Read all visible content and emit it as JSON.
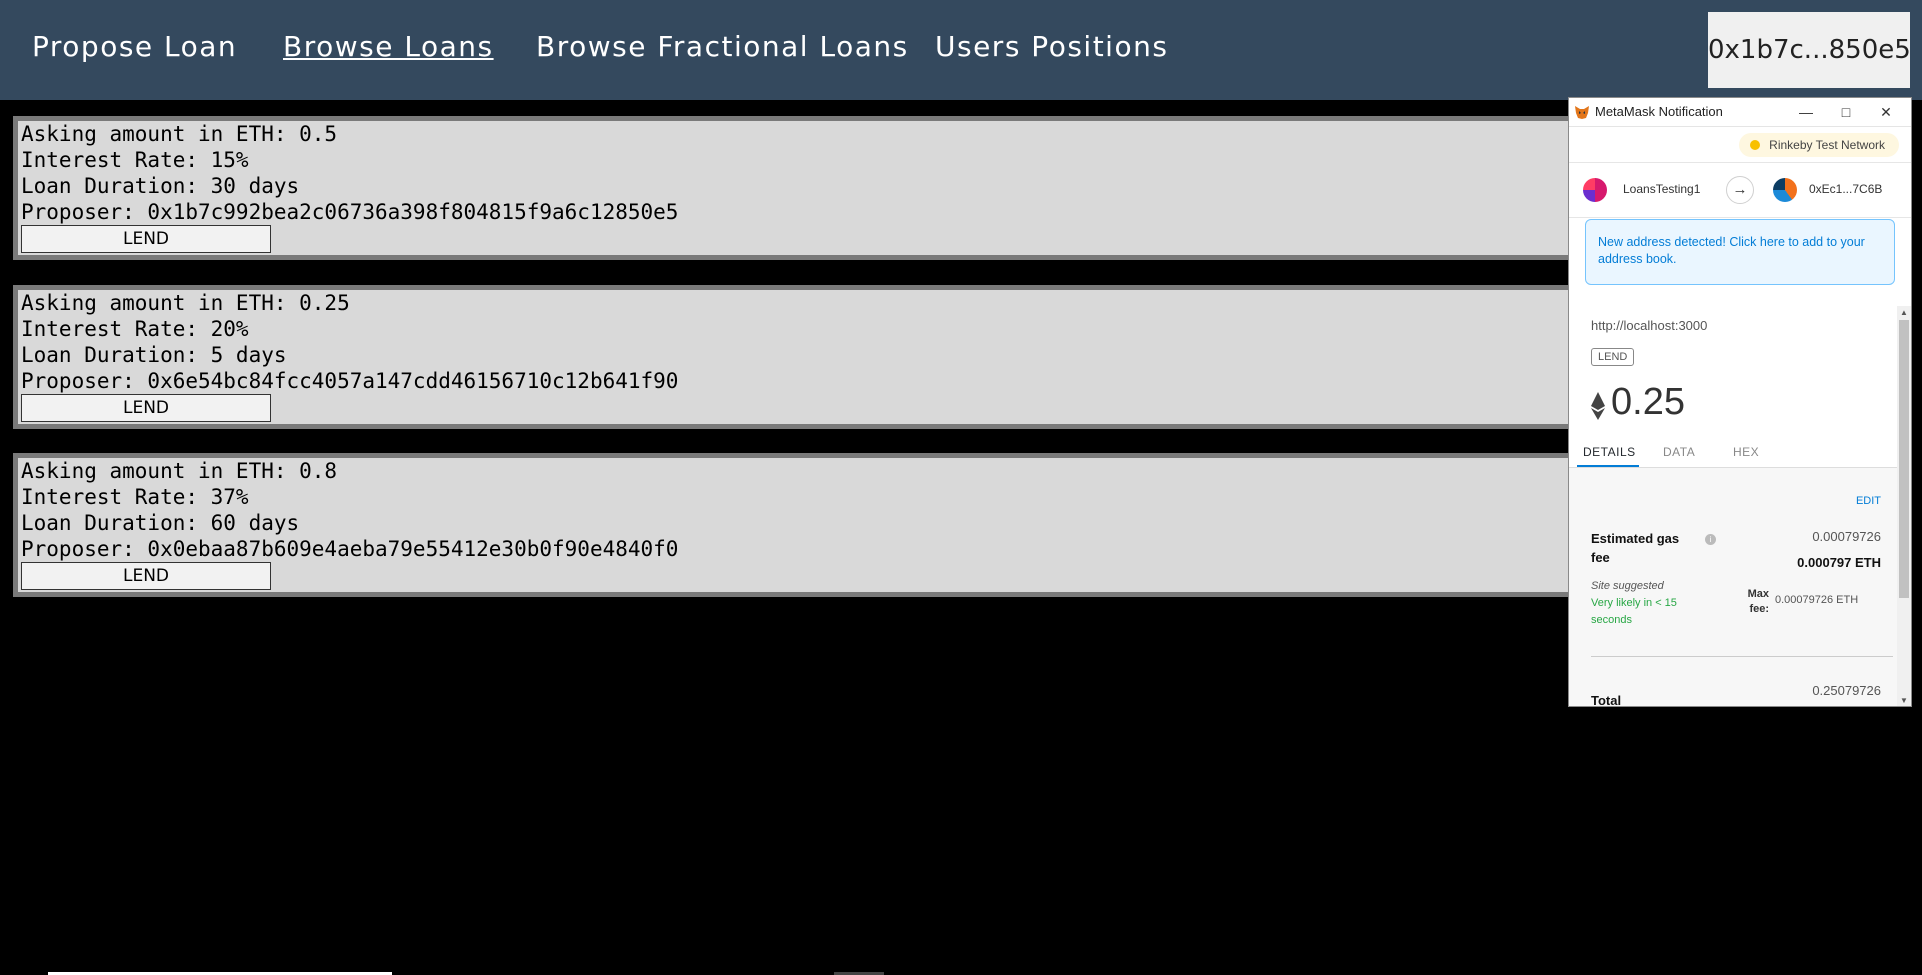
{
  "nav": {
    "links": [
      "Propose Loan",
      "Browse Loans",
      "Browse Fractional Loans",
      "Users Positions"
    ],
    "wallet": "0x1b7c...850e5"
  },
  "loans": [
    {
      "asking": "Asking amount in ETH: 0.5",
      "rate": "Interest Rate: 15%",
      "duration": "Loan Duration: 30 days",
      "proposer": "Proposer: 0x1b7c992bea2c06736a398f804815f9a6c12850e5",
      "button": "LEND"
    },
    {
      "asking": "Asking amount in ETH: 0.25",
      "rate": "Interest Rate: 20%",
      "duration": "Loan Duration: 5 days",
      "proposer": "Proposer: 0x6e54bc84fcc4057a147cdd46156710c12b641f90",
      "button": "LEND"
    },
    {
      "asking": "Asking amount in ETH: 0.8",
      "rate": "Interest Rate: 37%",
      "duration": "Loan Duration: 60 days",
      "proposer": "Proposer: 0x0ebaa87b609e4aeba79e55412e30b0f90e4840f0",
      "button": "LEND"
    }
  ],
  "metamask": {
    "window_title": "MetaMask Notification",
    "network": "Rinkeby Test Network",
    "from_account": "LoansTesting1",
    "to_account": "0xEc1...7C6B",
    "notice": "New address detected! Click here to add to your address book.",
    "origin": "http://localhost:3000",
    "method": "LEND",
    "amount": "0.25",
    "tabs": [
      "DETAILS",
      "DATA",
      "HEX"
    ],
    "edit": "EDIT",
    "gas_label": "Estimated gas fee",
    "gas_value": "0.00079726",
    "gas_value_eth": "0.000797 ETH",
    "site_suggested": "Site suggested",
    "likely": "Very likely in < 15 seconds",
    "max_fee_label": "Max fee:",
    "max_fee_value": "0.00079726 ETH",
    "total_label": "Total",
    "total_value": "0.25079726",
    "colors": {
      "network_dot": "#f8c000",
      "link_blue": "#037dd6",
      "success_green": "#28a745"
    }
  }
}
